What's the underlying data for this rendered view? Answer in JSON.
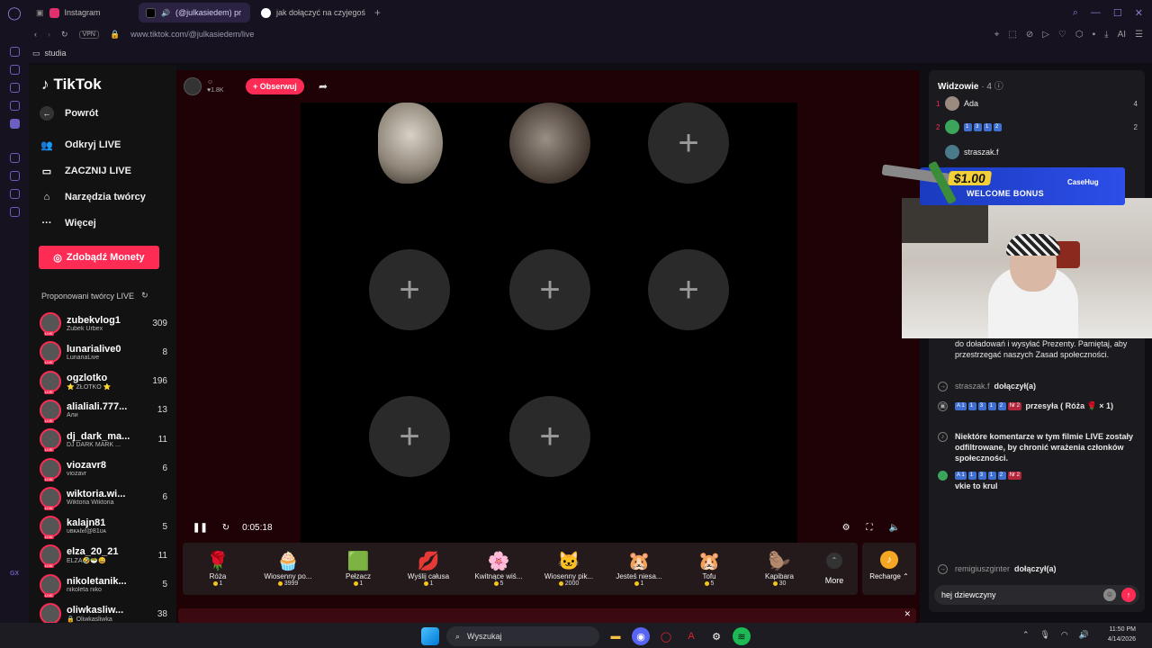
{
  "browser": {
    "tabs": [
      {
        "label": "Instagram",
        "color": "#e1306c"
      },
      {
        "label": "(@julkasiedem) pr",
        "color": "#111111",
        "active": true
      },
      {
        "label": "jak dołączyć na czyjegoś",
        "color": "#4285f4"
      }
    ],
    "vpn": "VPN",
    "url": "www.tiktok.com/@julkasiedem/live",
    "bookmark": "studia",
    "ai_label": "AI"
  },
  "nav": {
    "logo": "TikTok",
    "back": "Powrót",
    "items": [
      "Odkryj LIVE",
      "ZACZNIJ LIVE",
      "Narzędzia twórcy",
      "Więcej"
    ],
    "coins_button": "Zdobądź Monety",
    "suggested_title": "Proponowani twórcy LIVE",
    "creators": [
      {
        "name": "zubekvlog1",
        "sub": "Zubek Urbex",
        "count": "309"
      },
      {
        "name": "lunarialive0",
        "sub": "LunariaLive",
        "count": "8"
      },
      {
        "name": "ogzlotko",
        "sub": "⭐ ZŁOTKO ⭐",
        "count": "196"
      },
      {
        "name": "alialiali.777...",
        "sub": "Али",
        "count": "13"
      },
      {
        "name": "dj_dark_ma...",
        "sub": "DJ DARK MARK ...",
        "count": "11"
      },
      {
        "name": "viozavr8",
        "sub": "viozavr",
        "count": "6"
      },
      {
        "name": "wiktoria.wi...",
        "sub": "Wiktoria Wiktoria",
        "count": "6"
      },
      {
        "name": "kalajn81",
        "sub": "ᴜʙᴋᴀℓ𝖊ℓ@81ᴜᴀ",
        "count": "5"
      },
      {
        "name": "elza_20_21",
        "sub": "ELZA🤣🥗😄",
        "count": "11"
      },
      {
        "name": "nikoletanik...",
        "sub": "nikoleta niko",
        "count": "5"
      },
      {
        "name": "oliwkasliw...",
        "sub": "🔒 Oliwkasliwka",
        "count": "38"
      }
    ]
  },
  "stage": {
    "host_likes": "1.8K",
    "follow": "+ Obserwuj",
    "time": "0:05:18"
  },
  "gifts": [
    {
      "icon": "🌹",
      "name": "Róża",
      "price": "1"
    },
    {
      "icon": "🧁",
      "name": "Wiosenny po...",
      "price": "3999"
    },
    {
      "icon": "🟩",
      "name": "Pełzacz",
      "price": "1"
    },
    {
      "icon": "💋",
      "name": "Wyślij całusa",
      "price": "1"
    },
    {
      "icon": "🌸",
      "name": "Kwitnące wiś...",
      "price": "5"
    },
    {
      "icon": "🐱",
      "name": "Wiosenny pik...",
      "price": "2000"
    },
    {
      "icon": "🐹",
      "name": "Jesteś niesa...",
      "price": "1"
    },
    {
      "icon": "🐹",
      "name": "Tofu",
      "price": "5"
    },
    {
      "icon": "🦫",
      "name": "Kapibara",
      "price": "30"
    }
  ],
  "gift_more": "More",
  "recharge": "Recharge",
  "chat": {
    "title": "Widzowie",
    "viewer_count": "· 4",
    "viewers": [
      {
        "rank": "1",
        "name": "Ada",
        "count": "4",
        "badges": []
      },
      {
        "rank": "2",
        "name": "",
        "count": "2",
        "badges": [
          "1",
          "3",
          "1",
          "2"
        ]
      },
      {
        "rank": "",
        "name": "straszak.f",
        "count": "",
        "badges": []
      }
    ],
    "msg_info": "do doładowań i wysyłać Prezenty. Pamiętaj, aby przestrzegać naszych Zasad społeczności.",
    "join1_user": "straszak.f",
    "join1_text": "dołączył(a)",
    "gift_msg_badges": [
      "A 1",
      "1",
      "3",
      "1",
      "2"
    ],
    "gift_msg_rank": "Nr 2",
    "gift_msg_text": "przesyła ( Róża 🌹 × 1)",
    "filter_msg": "Niektóre komentarze w tym filmie LIVE zostały odfiltrowane, by chronić wrażenia członków społeczności.",
    "comment_badges": [
      "A 1",
      "1",
      "3",
      "1",
      "2"
    ],
    "comment_rank": "Nr 2",
    "comment_text": "vkie to krul",
    "join2_user": "remigiuszginter",
    "join2_text": "dołączył(a)",
    "input_value": "hej dziewczyny"
  },
  "ad": {
    "price": "$1.00",
    "text": "WELCOME BONUS",
    "brand": "CaseHug"
  },
  "taskbar": {
    "search": "Wyszukaj",
    "time": "11:50 PM",
    "date": "4/14/2026"
  },
  "rail_label": "GX"
}
